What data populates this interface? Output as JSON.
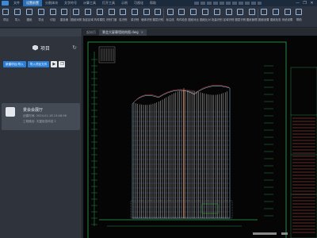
{
  "menu": {
    "items": [
      "文件",
      "设置前置",
      "分割体块",
      "文字符号",
      "计算工具",
      "打开工具",
      "示例",
      "可视化",
      "帮助"
    ],
    "active_index": 1
  },
  "window": {
    "minimize": "—",
    "maximize": "❐",
    "close": "✕"
  },
  "toolbar": {
    "tools": [
      {
        "label": "项目",
        "icon": "folder-icon"
      },
      {
        "label": "导入",
        "icon": "import-icon"
      },
      {
        "label": "图纸",
        "icon": "drawing-icon"
      },
      {
        "label": "导出",
        "icon": "export-icon"
      },
      {
        "label": "切割",
        "icon": "cut-icon"
      },
      {
        "label": "重选墙",
        "icon": "wall-icon"
      },
      {
        "label": "图纸对照",
        "icon": "compare-icon"
      },
      {
        "label": "指定区域",
        "icon": "region-icon"
      },
      {
        "label": "构件属性",
        "icon": "property-icon"
      },
      {
        "label": "识别门窗",
        "icon": "window-icon"
      },
      {
        "label": "柱识别",
        "icon": "column-icon"
      },
      {
        "label": "梁识别",
        "icon": "beam-icon"
      },
      {
        "label": "墙体识别",
        "icon": "wall-detect-icon"
      },
      {
        "label": "楼层识别",
        "icon": "floor-icon"
      },
      {
        "label": "标注线",
        "icon": "dimension-icon"
      },
      {
        "label": "构件检查",
        "icon": "check-icon"
      },
      {
        "label": "图纸对比",
        "icon": "diff-icon"
      },
      {
        "label": "图纸比对",
        "icon": "compare2-icon"
      },
      {
        "label": "批量识别",
        "icon": "batch-icon"
      },
      {
        "label": "区域识别",
        "icon": "area-icon"
      },
      {
        "label": "图层识别",
        "icon": "layer-icon"
      },
      {
        "label": "图纸管理",
        "icon": "manage-icon"
      },
      {
        "label": "图纸设置",
        "icon": "settings-icon"
      },
      {
        "label": "图纸检查",
        "icon": "verify-icon"
      },
      {
        "label": "系统设置",
        "icon": "gear-icon"
      },
      {
        "label": "帮助",
        "icon": "help-icon"
      }
    ]
  },
  "left_panel": {
    "title": "项目",
    "new_button": "新建项目/导入",
    "import_button": "导入项目文件",
    "project": {
      "name": "景会会展厅",
      "created": "创建时间: 2024-01-18 13:48:56",
      "path": "工程路径: 天翼信息科技 2"
    }
  },
  "tabs": [
    {
      "label": "起始页"
    },
    {
      "label": "景会大厦幕墙结构图.dwg"
    }
  ],
  "drawing": {
    "title_block_text": "景会大厦结构图",
    "accent_line_color": "#e06a2c"
  }
}
